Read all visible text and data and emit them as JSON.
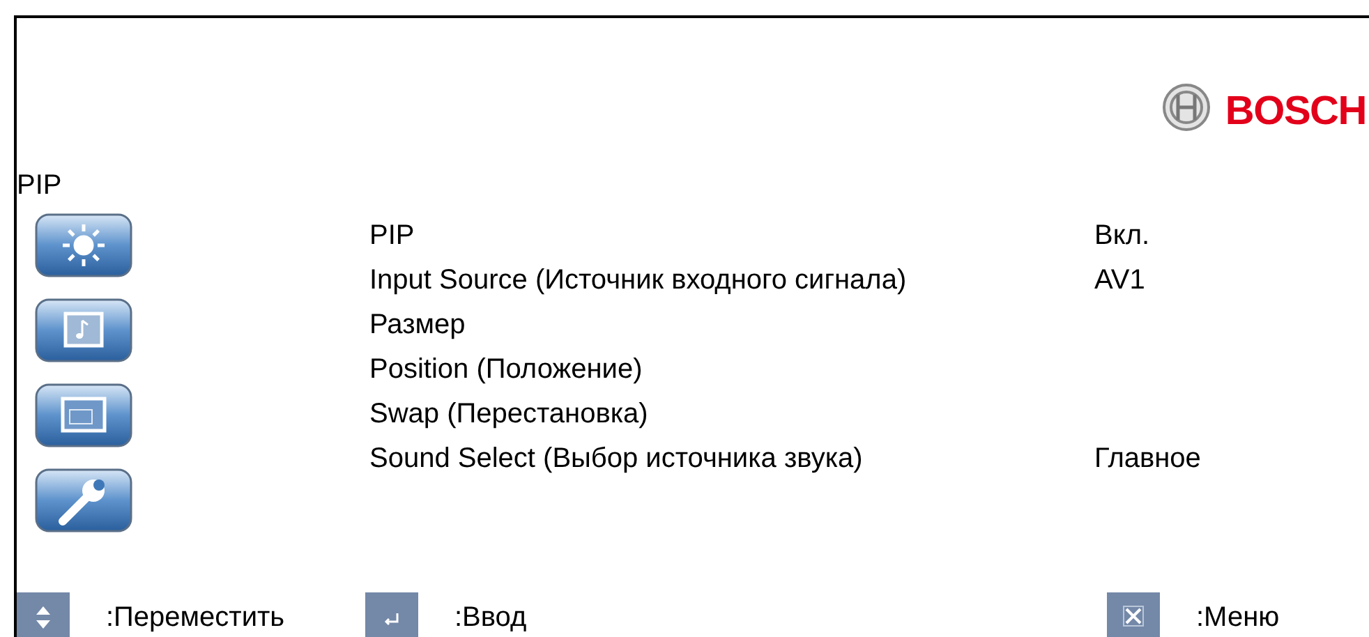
{
  "logo": {
    "text": "BOSCH"
  },
  "title": "PIP",
  "side_icons": [
    {
      "kind": "brightness"
    },
    {
      "kind": "audio"
    },
    {
      "kind": "screen"
    },
    {
      "kind": "wrench"
    }
  ],
  "menu": [
    {
      "label": "PIP",
      "value": "Вкл."
    },
    {
      "label": "Input Source (Источник входного сигнала)",
      "value": "AV1"
    },
    {
      "label": "Размер"
    },
    {
      "label": "Position (Положение)"
    },
    {
      "label": "Swap (Перестановка)"
    },
    {
      "label": "Sound Select (Выбор источника звука)",
      "value": "Главное"
    }
  ],
  "hints": [
    {
      "kind": "updown",
      "text": ":Переместить"
    },
    {
      "kind": "enter",
      "text": ":Ввод"
    },
    {
      "kind": "close",
      "text": ":Меню"
    }
  ]
}
